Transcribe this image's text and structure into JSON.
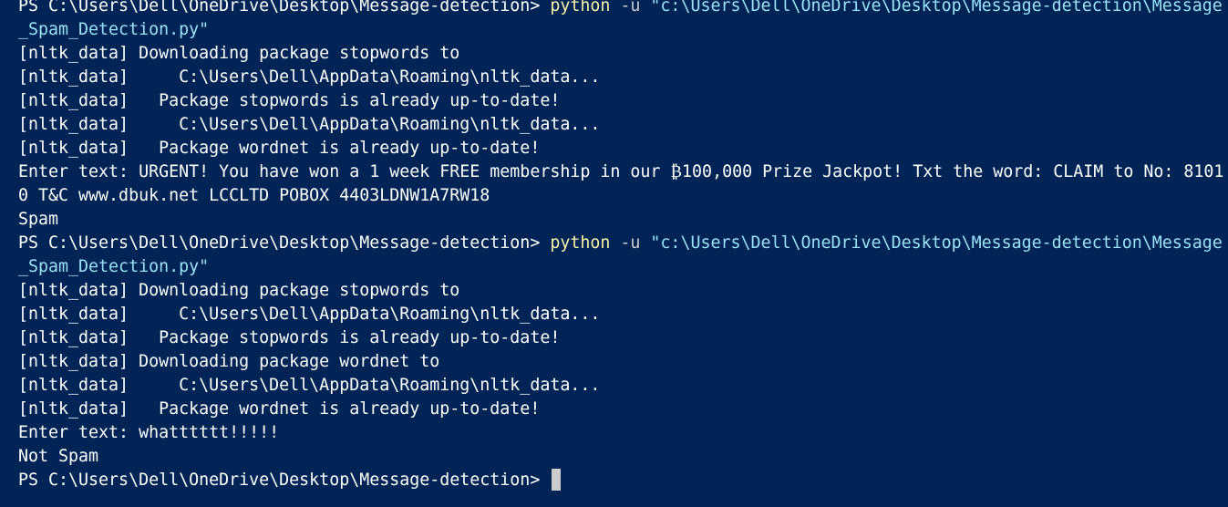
{
  "terminal": {
    "background": "#012456",
    "cmd_color": "#f9f1a5",
    "string_color": "#9ce1f7",
    "runs": [
      {
        "prompt": "PS C:\\Users\\Dell\\OneDrive\\Desktop\\Message-detection> ",
        "command": "python",
        "flag": " -u ",
        "path_line1": "\"c:\\Users\\Dell\\OneDrive\\Desktop\\Message-detection\\Message",
        "path_line2": "_Spam_Detection.py\"",
        "output": [
          "[nltk_data] Downloading package stopwords to",
          "[nltk_data]     C:\\Users\\Dell\\AppData\\Roaming\\nltk_data...",
          "[nltk_data]   Package stopwords is already up-to-date!",
          "[nltk_data]     C:\\Users\\Dell\\AppData\\Roaming\\nltk_data...",
          "[nltk_data]   Package wordnet is already up-to-date!",
          "Enter text: URGENT! You have won a 1 week FREE membership in our ₿100,000 Prize Jackpot! Txt the word: CLAIM to No: 8101",
          "0 T&C www.dbuk.net LCCLTD POBOX 4403LDNW1A7RW18",
          "Spam"
        ]
      },
      {
        "prompt": "PS C:\\Users\\Dell\\OneDrive\\Desktop\\Message-detection> ",
        "command": "python",
        "flag": " -u ",
        "path_line1": "\"c:\\Users\\Dell\\OneDrive\\Desktop\\Message-detection\\Message",
        "path_line2": "_Spam_Detection.py\"",
        "output": [
          "[nltk_data] Downloading package stopwords to",
          "[nltk_data]     C:\\Users\\Dell\\AppData\\Roaming\\nltk_data...",
          "[nltk_data]   Package stopwords is already up-to-date!",
          "[nltk_data] Downloading package wordnet to",
          "[nltk_data]     C:\\Users\\Dell\\AppData\\Roaming\\nltk_data...",
          "[nltk_data]   Package wordnet is already up-to-date!",
          "Enter text: whatttttt!!!!!",
          "Not Spam"
        ]
      }
    ],
    "final_prompt": "PS C:\\Users\\Dell\\OneDrive\\Desktop\\Message-detection> "
  }
}
